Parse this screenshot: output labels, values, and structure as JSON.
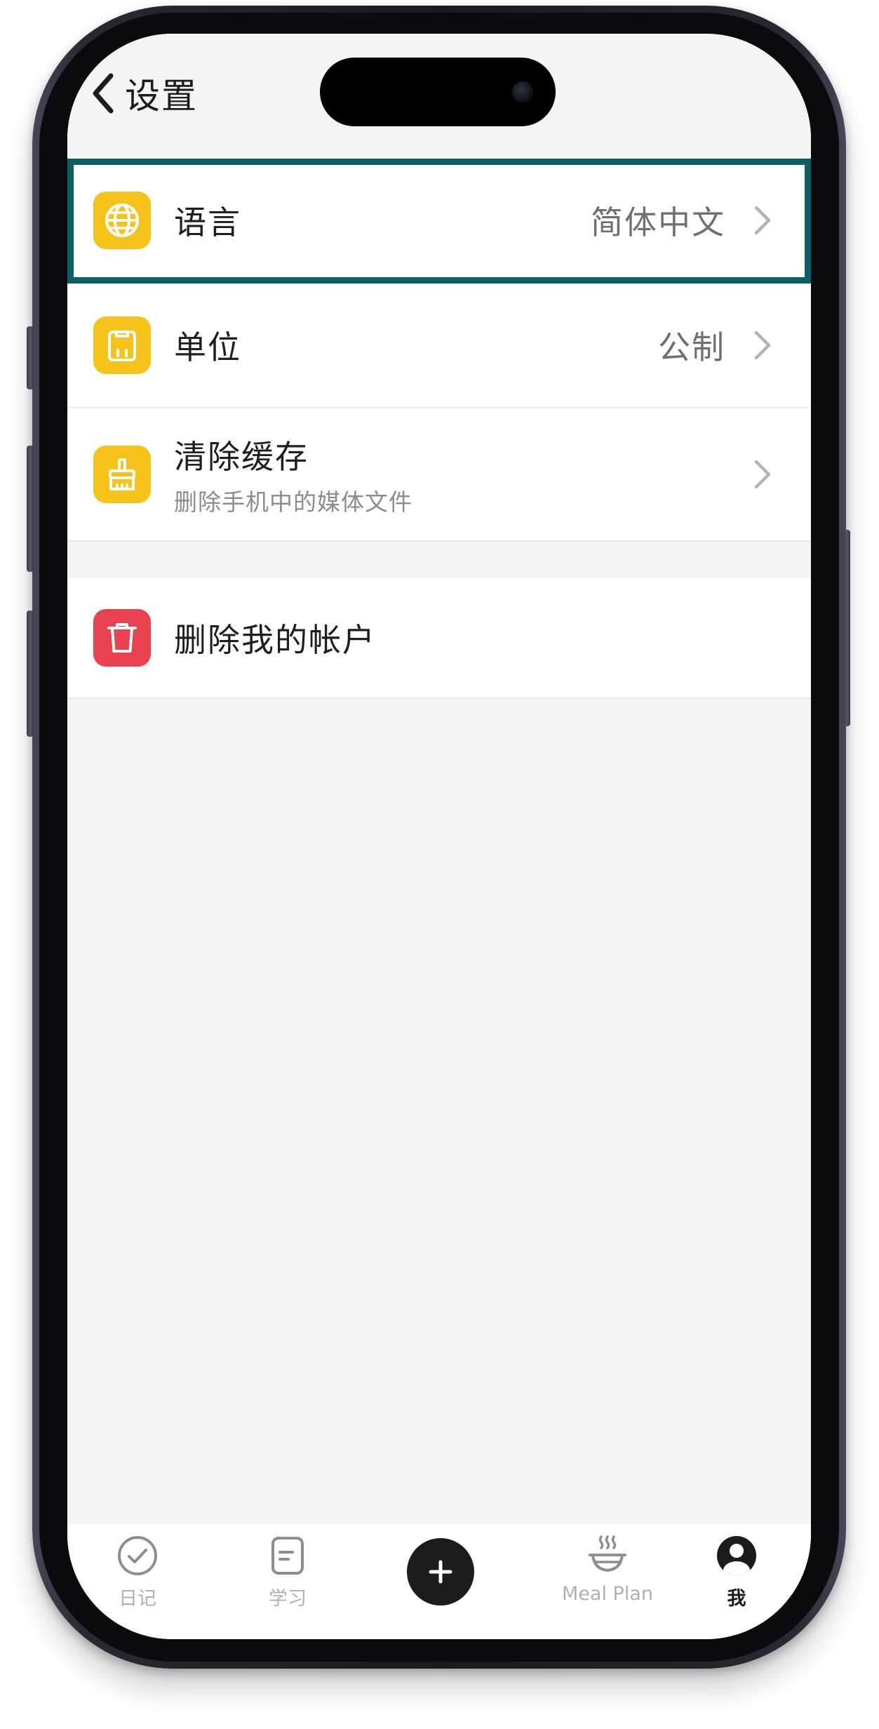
{
  "header": {
    "title": "设置"
  },
  "settings": [
    {
      "label": "语言",
      "value": "简体中文"
    },
    {
      "label": "单位",
      "value": "公制"
    },
    {
      "label": "清除缓存",
      "sub": "删除手机中的媒体文件"
    }
  ],
  "account": {
    "delete_label": "删除我的帐户"
  },
  "tabbar": {
    "tabs": [
      {
        "label": "日记"
      },
      {
        "label": "学习"
      },
      {
        "label": "Meal Plan"
      },
      {
        "label": "我"
      }
    ]
  },
  "colors": {
    "icon_yellow": "#f5c319",
    "icon_red": "#e8414f",
    "highlight_border": "#0b5d66"
  },
  "icons": {
    "language": "globe-icon",
    "units": "clipboard-icon",
    "cache": "broom-icon",
    "delete_account": "trash-icon",
    "diary": "check-circle-icon",
    "study": "note-icon",
    "add": "plus-icon",
    "meal_plan": "steaming-bowl-icon",
    "me": "user-avatar-icon"
  }
}
